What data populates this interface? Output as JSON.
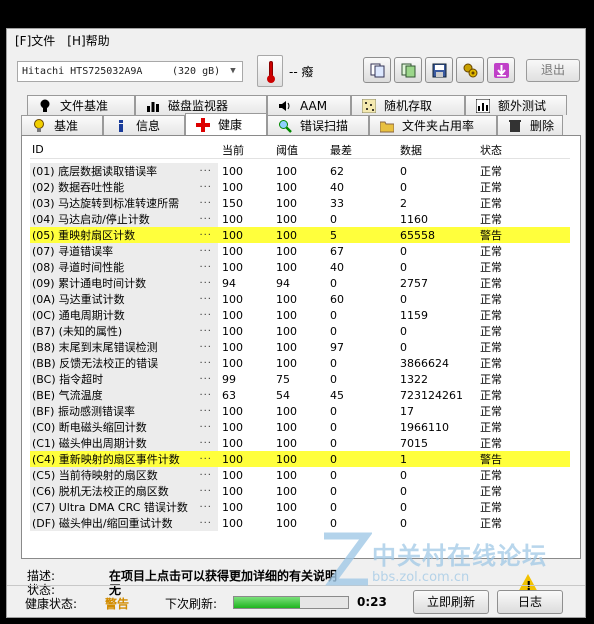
{
  "menu": {
    "file": "[F]文件",
    "help": "[H]帮助"
  },
  "toolbar": {
    "drive": "Hitachi HTS725032A9A",
    "size": "(320 gB)",
    "temperature": "-- 癈",
    "exit_label": "退出",
    "icons": [
      "copy-report-icon",
      "copy-all-icon",
      "save-icon",
      "settings-icon",
      "download-icon"
    ]
  },
  "tabs": {
    "row1": [
      "文件基准",
      "磁盘监视器",
      "AAM",
      "随机存取",
      "额外测试"
    ],
    "row2": [
      "基准",
      "信息",
      "健康",
      "错误扫描",
      "文件夹占用率",
      "删除"
    ],
    "active": "健康"
  },
  "table": {
    "headers": {
      "id": "ID",
      "current": "当前",
      "threshold": "阈值",
      "worst": "最差",
      "raw": "数据",
      "status": "状态"
    },
    "rows": [
      {
        "id": "(01) 底层数据读取错误率",
        "cur": "100",
        "thr": "100",
        "wst": "62",
        "raw": "0",
        "st": "正常",
        "warn": false
      },
      {
        "id": "(02) 数据吞吐性能",
        "cur": "100",
        "thr": "100",
        "wst": "40",
        "raw": "0",
        "st": "正常",
        "warn": false
      },
      {
        "id": "(03) 马达旋转到标准转速所需",
        "cur": "150",
        "thr": "100",
        "wst": "33",
        "raw": "2",
        "st": "正常",
        "warn": false
      },
      {
        "id": "(04) 马达启动/停止计数",
        "cur": "100",
        "thr": "100",
        "wst": "0",
        "raw": "1160",
        "st": "正常",
        "warn": false
      },
      {
        "id": "(05) 重映射扇区计数",
        "cur": "100",
        "thr": "100",
        "wst": "5",
        "raw": "65558",
        "st": "警告",
        "warn": true
      },
      {
        "id": "(07) 寻道错误率",
        "cur": "100",
        "thr": "100",
        "wst": "67",
        "raw": "0",
        "st": "正常",
        "warn": false
      },
      {
        "id": "(08) 寻道时间性能",
        "cur": "100",
        "thr": "100",
        "wst": "40",
        "raw": "0",
        "st": "正常",
        "warn": false
      },
      {
        "id": "(09) 累计通电时间计数",
        "cur": "94",
        "thr": "94",
        "wst": "0",
        "raw": "2757",
        "st": "正常",
        "warn": false
      },
      {
        "id": "(0A) 马达重试计数",
        "cur": "100",
        "thr": "100",
        "wst": "60",
        "raw": "0",
        "st": "正常",
        "warn": false
      },
      {
        "id": "(0C) 通电周期计数",
        "cur": "100",
        "thr": "100",
        "wst": "0",
        "raw": "1159",
        "st": "正常",
        "warn": false
      },
      {
        "id": "(B7) (未知的属性)",
        "cur": "100",
        "thr": "100",
        "wst": "0",
        "raw": "0",
        "st": "正常",
        "warn": false
      },
      {
        "id": "(B8) 末尾到末尾错误检测",
        "cur": "100",
        "thr": "100",
        "wst": "97",
        "raw": "0",
        "st": "正常",
        "warn": false
      },
      {
        "id": "(BB) 反馈无法校正的错误",
        "cur": "100",
        "thr": "100",
        "wst": "0",
        "raw": "3866624",
        "st": "正常",
        "warn": false
      },
      {
        "id": "(BC) 指令超时",
        "cur": "99",
        "thr": "75",
        "wst": "0",
        "raw": "1322",
        "st": "正常",
        "warn": false
      },
      {
        "id": "(BE) 气流温度",
        "cur": "63",
        "thr": "54",
        "wst": "45",
        "raw": "723124261",
        "st": "正常",
        "warn": false
      },
      {
        "id": "(BF) 振动感测错误率",
        "cur": "100",
        "thr": "100",
        "wst": "0",
        "raw": "17",
        "st": "正常",
        "warn": false
      },
      {
        "id": "(C0) 断电磁头缩回计数",
        "cur": "100",
        "thr": "100",
        "wst": "0",
        "raw": "1966110",
        "st": "正常",
        "warn": false
      },
      {
        "id": "(C1) 磁头伸出周期计数",
        "cur": "100",
        "thr": "100",
        "wst": "0",
        "raw": "7015",
        "st": "正常",
        "warn": false
      },
      {
        "id": "(C4) 重新映射的扇区事件计数",
        "cur": "100",
        "thr": "100",
        "wst": "0",
        "raw": "1",
        "st": "警告",
        "warn": true
      },
      {
        "id": "(C5) 当前待映射的扇区数",
        "cur": "100",
        "thr": "100",
        "wst": "0",
        "raw": "0",
        "st": "正常",
        "warn": false
      },
      {
        "id": "(C6) 脱机无法校正的扇区数",
        "cur": "100",
        "thr": "100",
        "wst": "0",
        "raw": "0",
        "st": "正常",
        "warn": false
      },
      {
        "id": "(C7) Ultra DMA CRC 错误计数",
        "cur": "100",
        "thr": "100",
        "wst": "0",
        "raw": "0",
        "st": "正常",
        "warn": false
      },
      {
        "id": "(DF) 磁头伸出/缩回重试计数",
        "cur": "100",
        "thr": "100",
        "wst": "0",
        "raw": "0",
        "st": "正常",
        "warn": false
      }
    ]
  },
  "description": {
    "desc_label": "描述:",
    "desc_value": "在项目上点击可以获得更加详细的有关说明",
    "status_label": "状态:",
    "status_value": "无"
  },
  "statusbar": {
    "health_label": "健康状态:",
    "health_value": "警告",
    "refresh_label": "下次刷新:",
    "progress": 0.58,
    "countdown": "0:23",
    "refresh_now": "立即刷新",
    "log": "日志"
  },
  "watermark": {
    "cn": "中关村在线论坛",
    "url": "bbs.zol.com.cn"
  },
  "colors": {
    "warn_row": "#ffff3c",
    "health_warn": "#d28c00",
    "progress": "#1fb51f"
  }
}
